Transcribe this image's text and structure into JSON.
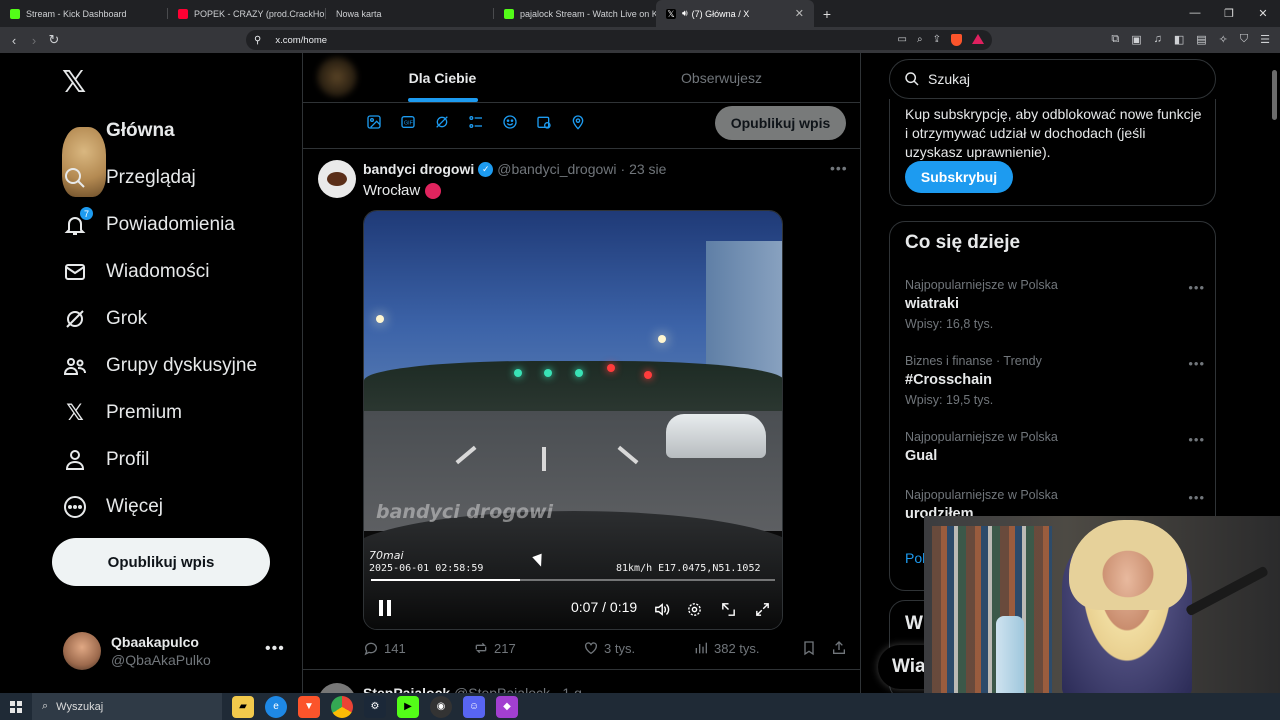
{
  "browser": {
    "tabs": [
      {
        "title": "Stream - Kick Dashboard",
        "color": "#53fc18"
      },
      {
        "title": "POPEK - CRAZY (prod.CrackHouse)",
        "color": "#ff0033"
      },
      {
        "title": "Nowa karta",
        "color": ""
      },
      {
        "title": "pajalock Stream - Watch Live on Kick",
        "color": "#53fc18"
      },
      {
        "title": "(7) Główna / X",
        "color": "#ffffff"
      }
    ],
    "address": "x.com/home"
  },
  "sidebar": {
    "items": [
      {
        "label": "Główna",
        "icon": "home-icon"
      },
      {
        "label": "Przeglądaj",
        "icon": "search-icon"
      },
      {
        "label": "Powiadomienia",
        "icon": "bell-icon",
        "badge": "7"
      },
      {
        "label": "Wiadomości",
        "icon": "mail-icon"
      },
      {
        "label": "Grok",
        "icon": "grok-icon"
      },
      {
        "label": "Grupy dyskusyjne",
        "icon": "communities-icon"
      },
      {
        "label": "Premium",
        "icon": "x-premium-icon"
      },
      {
        "label": "Profil",
        "icon": "profile-icon"
      },
      {
        "label": "Więcej",
        "icon": "more-circle-icon"
      }
    ],
    "post_button": "Opublikuj wpis",
    "account": {
      "name": "Qbaakapulco",
      "handle": "@QbaAkaPulko"
    }
  },
  "feed": {
    "tabs": [
      "Dla Ciebie",
      "Obserwujesz"
    ],
    "composer_post_button": "Opublikuj wpis",
    "tweet": {
      "author": "bandyci drogowi",
      "handle": "@bandyci_drogowi",
      "date": "· 23 sie",
      "text": "Wrocław",
      "video": {
        "watermark": "bandyci drogowi",
        "brand": "70mai",
        "osd_left": "2025-06-01 02:58:59",
        "osd_right": "81km/h E17.0475,N51.1052",
        "time": "0:07 / 0:19",
        "progress": 0.37
      },
      "stats": {
        "replies": "141",
        "reposts": "217",
        "likes": "3 tys.",
        "views": "382 tys."
      }
    },
    "next": {
      "author": "StepPajalock",
      "handle": "@StepPajalock · 1 g"
    }
  },
  "right": {
    "search_placeholder": "Szukaj",
    "premium_text": "Kup subskrypcję, aby odblokować nowe funkcje i otrzymywać udział w dochodach (jeśli uzyskasz uprawnienie).",
    "subscribe": "Subskrybuj",
    "trends_title": "Co się dzieje",
    "trends": [
      {
        "meta": "Najpopularniejsze w Polska",
        "name": "wiatraki",
        "count": "Wpisy: 16,8 tys."
      },
      {
        "meta": "Biznes i finanse · Trendy",
        "name": "#Crosschain",
        "count": "Wpisy: 19,5 tys."
      },
      {
        "meta": "Najpopularniejsze w Polska",
        "name": "Gual",
        "count": ""
      },
      {
        "meta": "Najpopularniejsze w Polska",
        "name": "urodziłem",
        "count": ""
      }
    ],
    "show_more": "Poka",
    "wi_title": "Wi",
    "wi_bar": "Wia"
  },
  "taskbar": {
    "search": "Wyszukaj"
  }
}
